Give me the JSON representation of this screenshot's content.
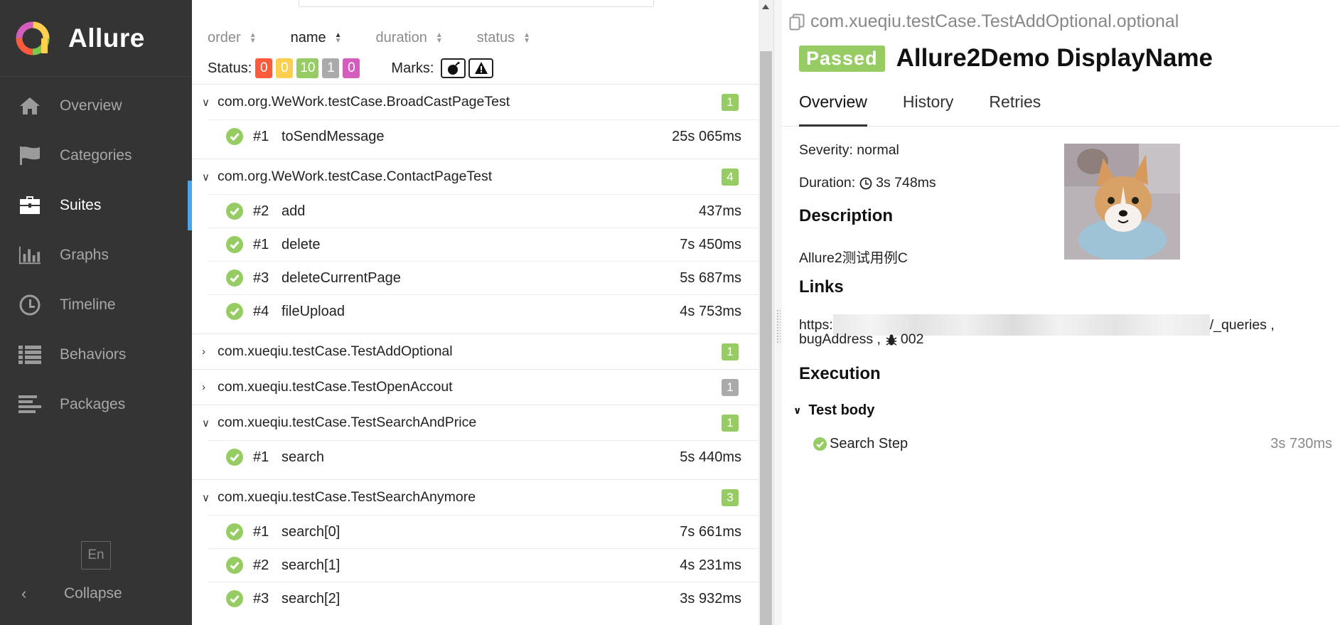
{
  "brand": {
    "name": "Allure"
  },
  "colors": {
    "passed": "#97cc64",
    "failed": "#fd5a3e",
    "broken": "#ffd050",
    "skipped": "#aaaaaa",
    "unknown": "#d35ebe",
    "accent": "#4fa3e0",
    "sidebar": "#343434"
  },
  "sidebar": {
    "items": [
      {
        "label": "Overview",
        "icon": "home-icon"
      },
      {
        "label": "Categories",
        "icon": "flag-icon"
      },
      {
        "label": "Suites",
        "icon": "briefcase-icon"
      },
      {
        "label": "Graphs",
        "icon": "bar-chart-icon"
      },
      {
        "label": "Timeline",
        "icon": "clock-icon"
      },
      {
        "label": "Behaviors",
        "icon": "list-icon"
      },
      {
        "label": "Packages",
        "icon": "align-left-icon"
      }
    ],
    "active": "Suites",
    "language": "En",
    "collapse_label": "Collapse"
  },
  "sort": {
    "order": "order",
    "name": "name",
    "duration": "duration",
    "status": "status"
  },
  "filter": {
    "status_label": "Status:",
    "counts": {
      "failed": "0",
      "broken": "0",
      "passed": "10",
      "skipped": "1",
      "unknown": "0"
    },
    "marks_label": "Marks:"
  },
  "groups": [
    {
      "name": "com.org.WeWork.testCase.BroadCastPageTest",
      "count": "1",
      "expanded": true,
      "cases": [
        {
          "num": "#1",
          "name": "toSendMessage",
          "duration": "25s 065ms"
        }
      ]
    },
    {
      "name": "com.org.WeWork.testCase.ContactPageTest",
      "count": "4",
      "expanded": true,
      "cases": [
        {
          "num": "#2",
          "name": "add",
          "duration": "437ms"
        },
        {
          "num": "#1",
          "name": "delete",
          "duration": "7s 450ms"
        },
        {
          "num": "#3",
          "name": "deleteCurrentPage",
          "duration": "5s 687ms"
        },
        {
          "num": "#4",
          "name": "fileUpload",
          "duration": "4s 753ms"
        }
      ]
    },
    {
      "name": "com.xueqiu.testCase.TestAddOptional",
      "count": "1",
      "expanded": false,
      "cases": []
    },
    {
      "name": "com.xueqiu.testCase.TestOpenAccout",
      "count": "1",
      "expanded": false,
      "cases": []
    },
    {
      "name": "com.xueqiu.testCase.TestSearchAndPrice",
      "count": "1",
      "expanded": true,
      "cases": [
        {
          "num": "#1",
          "name": "search",
          "duration": "5s 440ms"
        }
      ]
    },
    {
      "name": "com.xueqiu.testCase.TestSearchAnymore",
      "count": "3",
      "expanded": true,
      "cases": [
        {
          "num": "#1",
          "name": "search[0]",
          "duration": "7s 661ms"
        },
        {
          "num": "#2",
          "name": "search[1]",
          "duration": "4s 231ms"
        },
        {
          "num": "#3",
          "name": "search[2]",
          "duration": "3s 932ms"
        }
      ]
    }
  ],
  "detail": {
    "breadcrumb": "com.xueqiu.testCase.TestAddOptional.optional",
    "status": "Passed",
    "title": "Allure2Demo DisplayName",
    "tabs": [
      "Overview",
      "History",
      "Retries"
    ],
    "severity": "Severity: normal",
    "duration_label": "Duration:",
    "duration": "3s 748ms",
    "description_heading": "Description",
    "description": "Allure2测试用例C",
    "links_heading": "Links",
    "link_prefix": "https:",
    "link_suffix": "/_queries ,",
    "bug_label": "bugAddress ,",
    "bug_id": "002",
    "execution_heading": "Execution",
    "test_body": "Test body",
    "step_name": "Search Step",
    "step_duration": "3s 730ms"
  }
}
